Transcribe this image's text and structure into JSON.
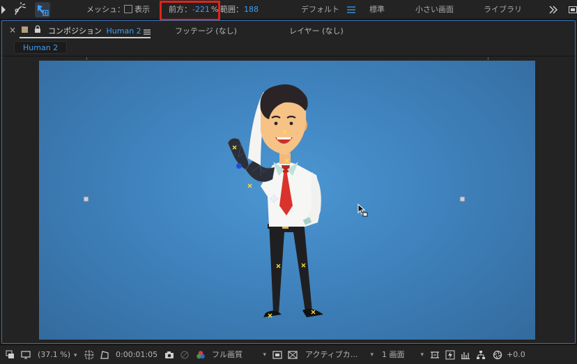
{
  "toolbar": {
    "mesh_label": "メッシュ：",
    "show_label": "表示",
    "forward_label": "前方：",
    "forward_value": "-221",
    "forward_unit": "%",
    "range_label": "範囲：",
    "range_value": "188",
    "workspaces": [
      "デフォルト",
      "標準",
      "小さい画面",
      "ライブラリ"
    ],
    "workspace_menu_icon": "hamburger-icon",
    "overflow_icon": "double-chevron-right-icon"
  },
  "panel": {
    "close_glyph": "×",
    "comp_tab_prefix": "コンポジション",
    "comp_tab_name": "Human 2",
    "footage_tab": "フッテージ (なし)",
    "layer_tab": "レイヤー (なし)",
    "comp_chip": "Human 2"
  },
  "bottombar": {
    "zoom": "(37.1 %)",
    "timecode": "0:00:01:05",
    "quality": "フル画質",
    "active_camera": "アクティブカ...",
    "views": "1 画面",
    "exposure": "+0.0"
  },
  "colors": {
    "accent": "#3f9ef5",
    "highlight_frame": "#e0241a",
    "comp_background": "#4488c6"
  }
}
